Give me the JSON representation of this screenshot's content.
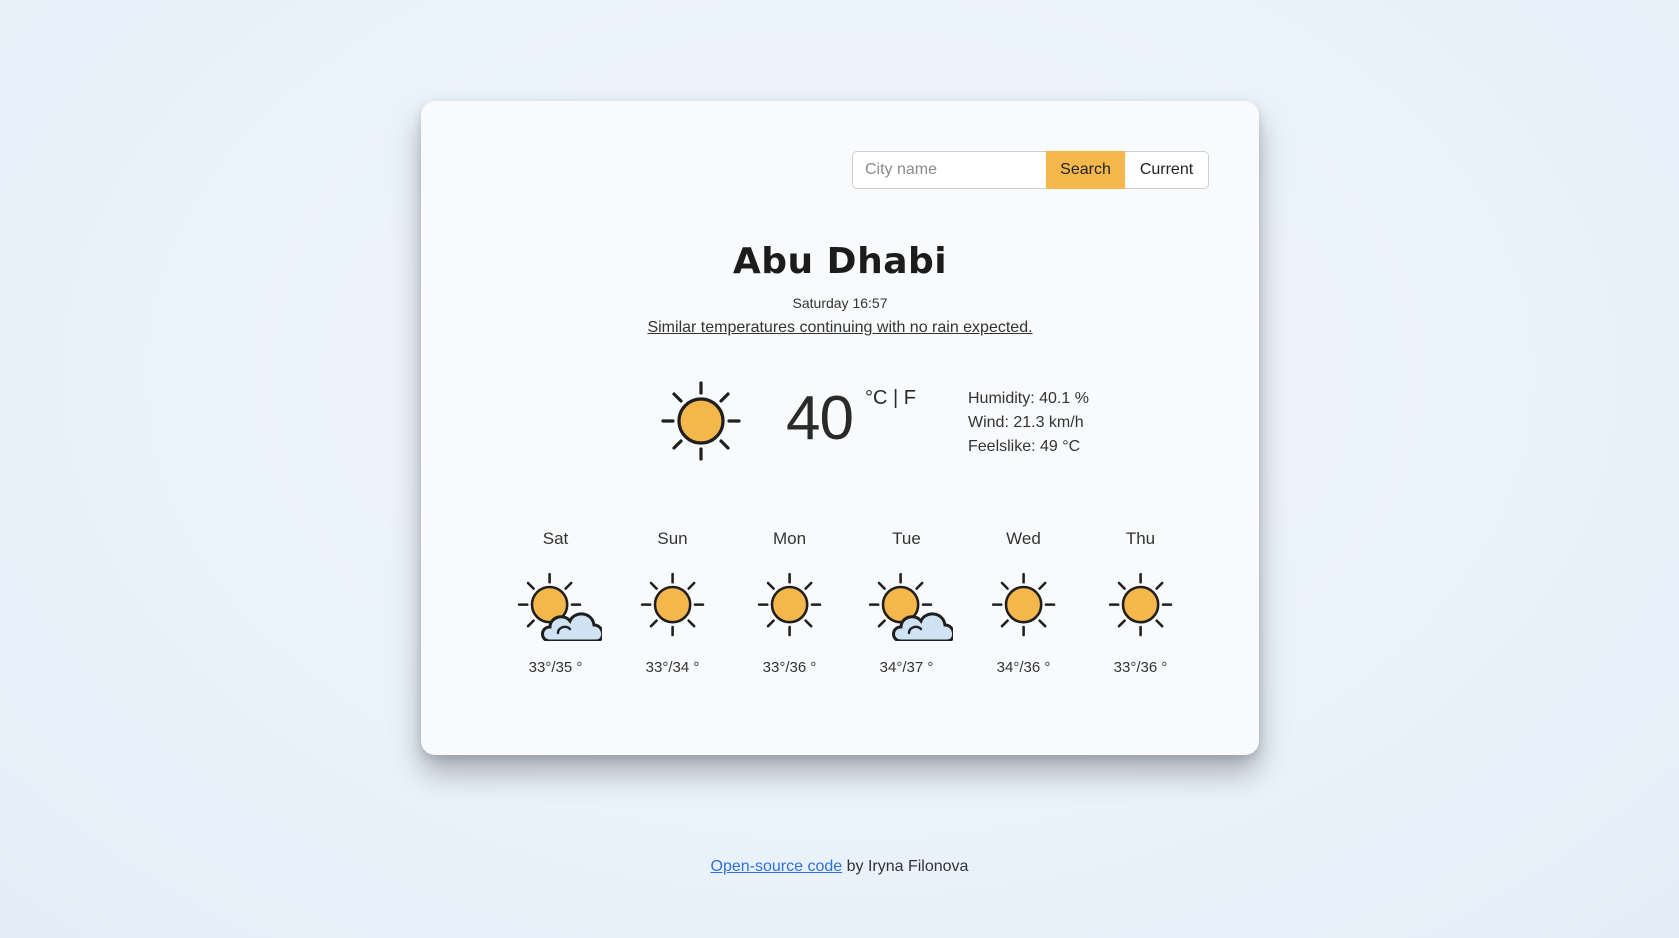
{
  "search": {
    "placeholder": "City name",
    "value": "",
    "search_label": "Search",
    "current_label": "Current"
  },
  "weather": {
    "city": "Abu Dhabi",
    "datetime": "Saturday 16:57",
    "description": "Similar temperatures continuing with no rain expected.",
    "icon": "sun-icon",
    "temperature": "40",
    "unit_c": "°C",
    "unit_separator": "|",
    "unit_f": "F",
    "humidity": "Humidity: 40.1 %",
    "wind": "Wind: 21.3 km/h",
    "feelslike": "Feelslike: 49 °C"
  },
  "forecast": [
    {
      "day": "Sat",
      "icon": "sun-cloud-icon",
      "temps": "33°/35 °"
    },
    {
      "day": "Sun",
      "icon": "sun-icon",
      "temps": "33°/34 °"
    },
    {
      "day": "Mon",
      "icon": "sun-icon",
      "temps": "33°/36 °"
    },
    {
      "day": "Tue",
      "icon": "sun-cloud-icon",
      "temps": "34°/37 °"
    },
    {
      "day": "Wed",
      "icon": "sun-icon",
      "temps": "34°/36 °"
    },
    {
      "day": "Thu",
      "icon": "sun-icon",
      "temps": "33°/36 °"
    }
  ],
  "footer": {
    "link_text": "Open-source code",
    "byline": " by Iryna Filonova"
  },
  "colors": {
    "accent": "#f4b74c",
    "sun": "#f4b74c",
    "cloud": "#cfe3f5",
    "link": "#2f6fdf"
  }
}
